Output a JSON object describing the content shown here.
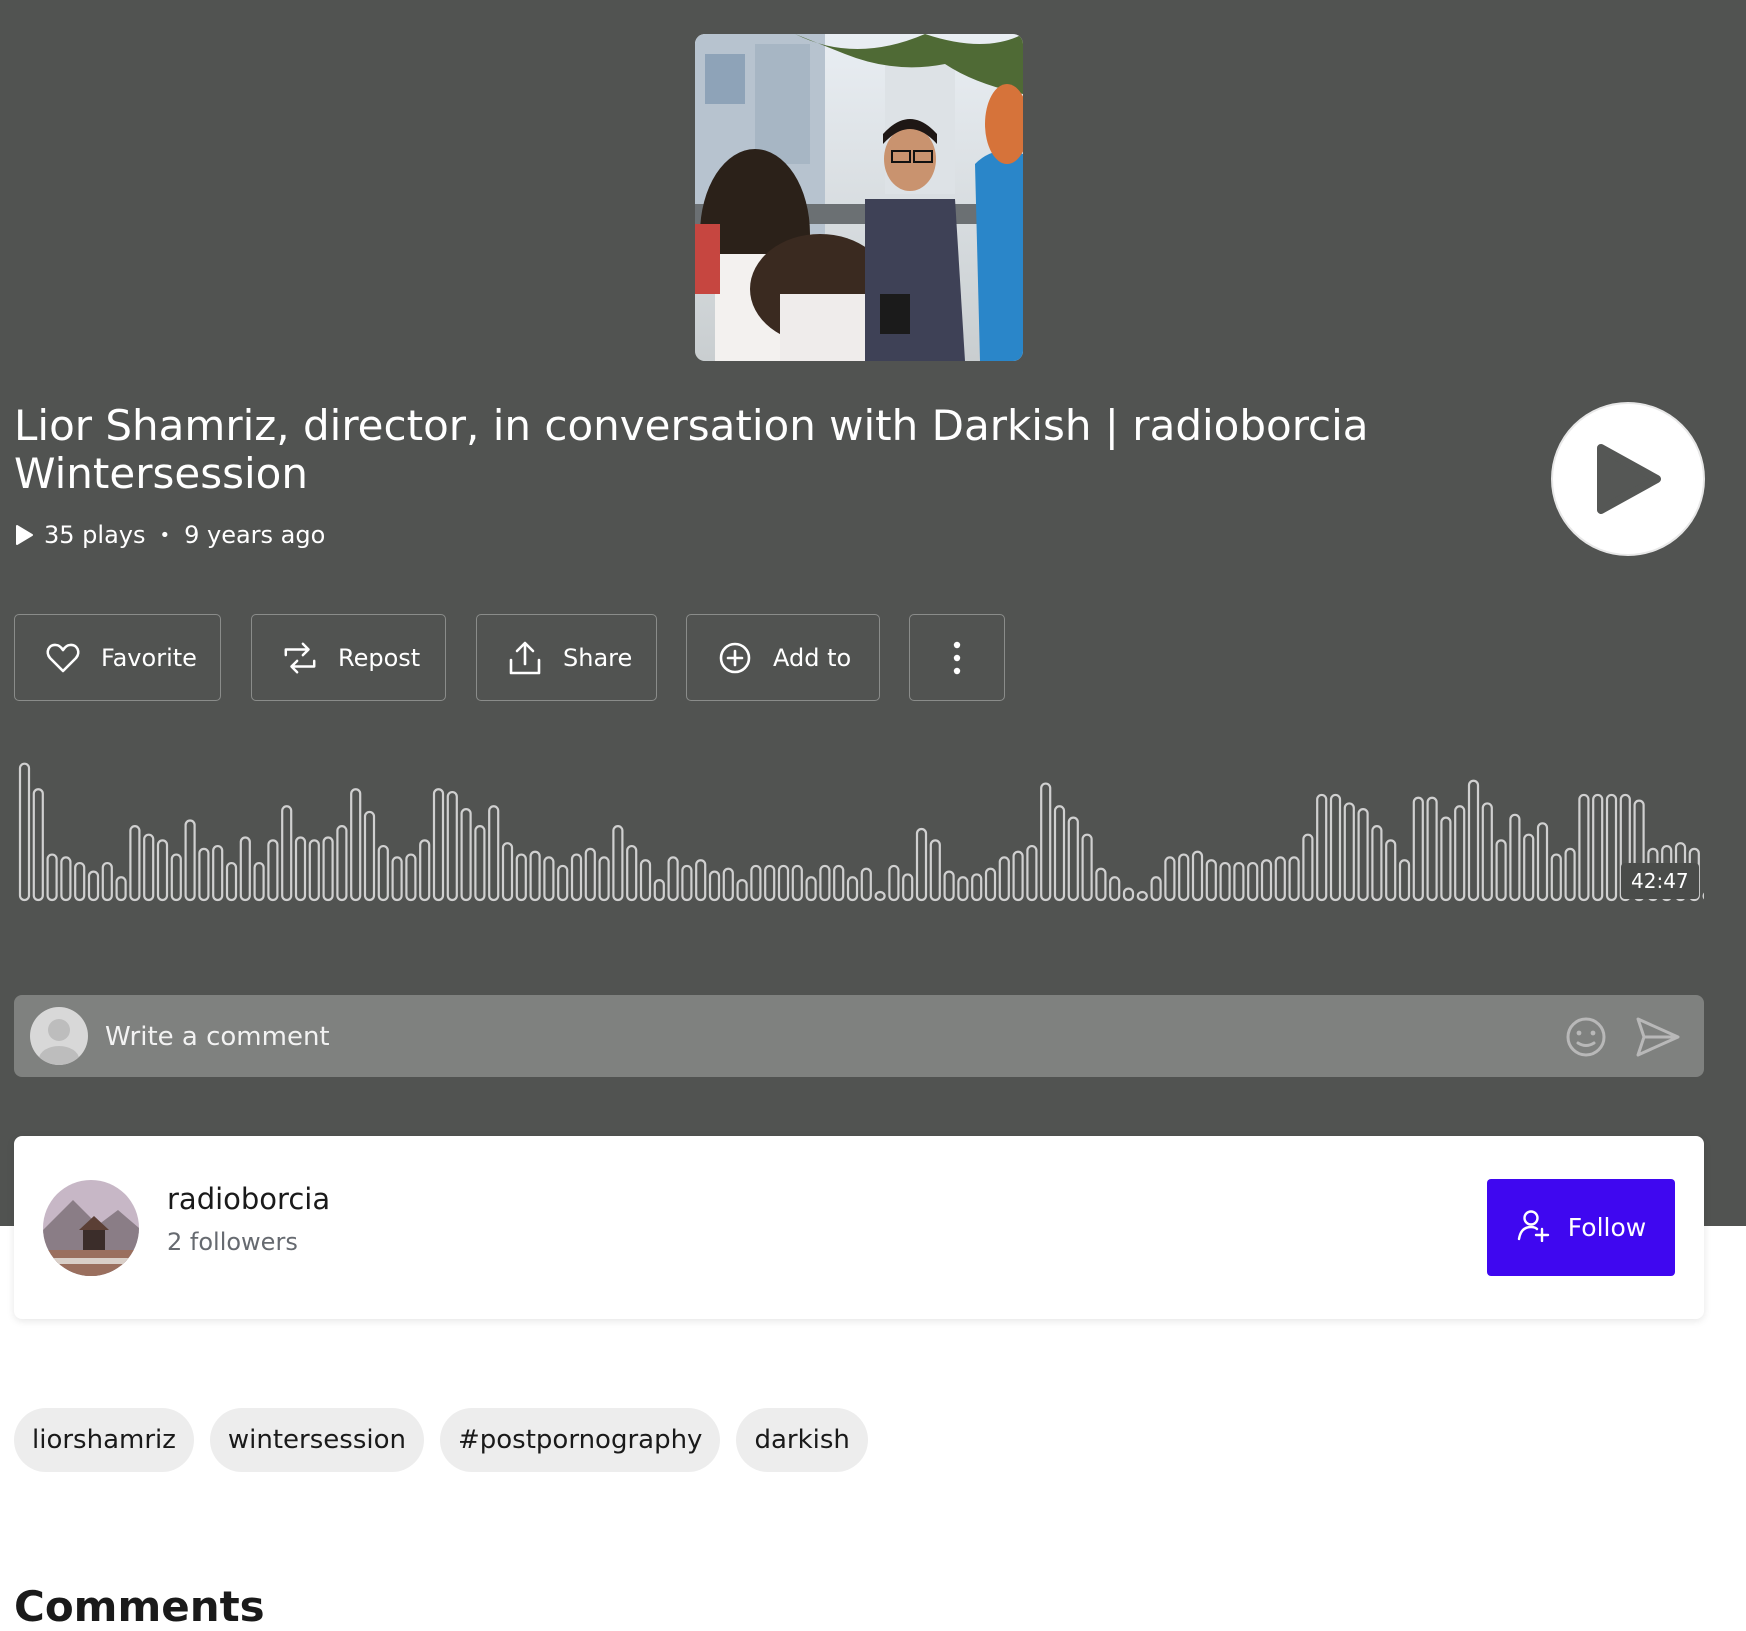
{
  "track": {
    "title": "Lior Shamriz, director, in conversation with Darkish | radioborcia Wintersession",
    "plays": "35 plays",
    "separator": "•",
    "posted": "9 years ago",
    "duration": "42:47"
  },
  "actions": {
    "favorite_label": "Favorite",
    "repost_label": "Repost",
    "share_label": "Share",
    "add_to_label": "Add to"
  },
  "comment": {
    "placeholder": "Write a comment"
  },
  "artist": {
    "name": "radioborcia",
    "followers": "2 followers",
    "follow_label": "Follow"
  },
  "tags": [
    "liorshamriz",
    "wintersession",
    "#postpornography",
    "darkish"
  ],
  "comments_section": {
    "title": "Comments"
  },
  "colors": {
    "hero_background": "#515351",
    "follow_accent": "#3f07f0",
    "waveform": "#d0d0d0"
  },
  "waveform_amplitudes": [
    0.96,
    0.78,
    0.32,
    0.3,
    0.26,
    0.2,
    0.26,
    0.16,
    0.52,
    0.46,
    0.42,
    0.32,
    0.56,
    0.36,
    0.38,
    0.26,
    0.44,
    0.26,
    0.42,
    0.66,
    0.44,
    0.42,
    0.44,
    0.52,
    0.78,
    0.62,
    0.38,
    0.3,
    0.32,
    0.42,
    0.78,
    0.76,
    0.64,
    0.52,
    0.66,
    0.4,
    0.32,
    0.34,
    0.3,
    0.24,
    0.32,
    0.36,
    0.3,
    0.52,
    0.38,
    0.28,
    0.14,
    0.3,
    0.24,
    0.28,
    0.2,
    0.22,
    0.14,
    0.24,
    0.24,
    0.24,
    0.24,
    0.16,
    0.24,
    0.24,
    0.16,
    0.22,
    0.04,
    0.24,
    0.18,
    0.5,
    0.42,
    0.2,
    0.16,
    0.18,
    0.22,
    0.3,
    0.34,
    0.38,
    0.82,
    0.66,
    0.58,
    0.46,
    0.22,
    0.16,
    0.08,
    0.04,
    0.16,
    0.3,
    0.32,
    0.34,
    0.28,
    0.26,
    0.26,
    0.26,
    0.28,
    0.3,
    0.3,
    0.46,
    0.74,
    0.74,
    0.68,
    0.64,
    0.52,
    0.42,
    0.28,
    0.72,
    0.72,
    0.58,
    0.66,
    0.84,
    0.68,
    0.42,
    0.6,
    0.46,
    0.54,
    0.32,
    0.36,
    0.74,
    0.74,
    0.74,
    0.74,
    0.7,
    0.36,
    0.38,
    0.4,
    0.36,
    0.04
  ]
}
